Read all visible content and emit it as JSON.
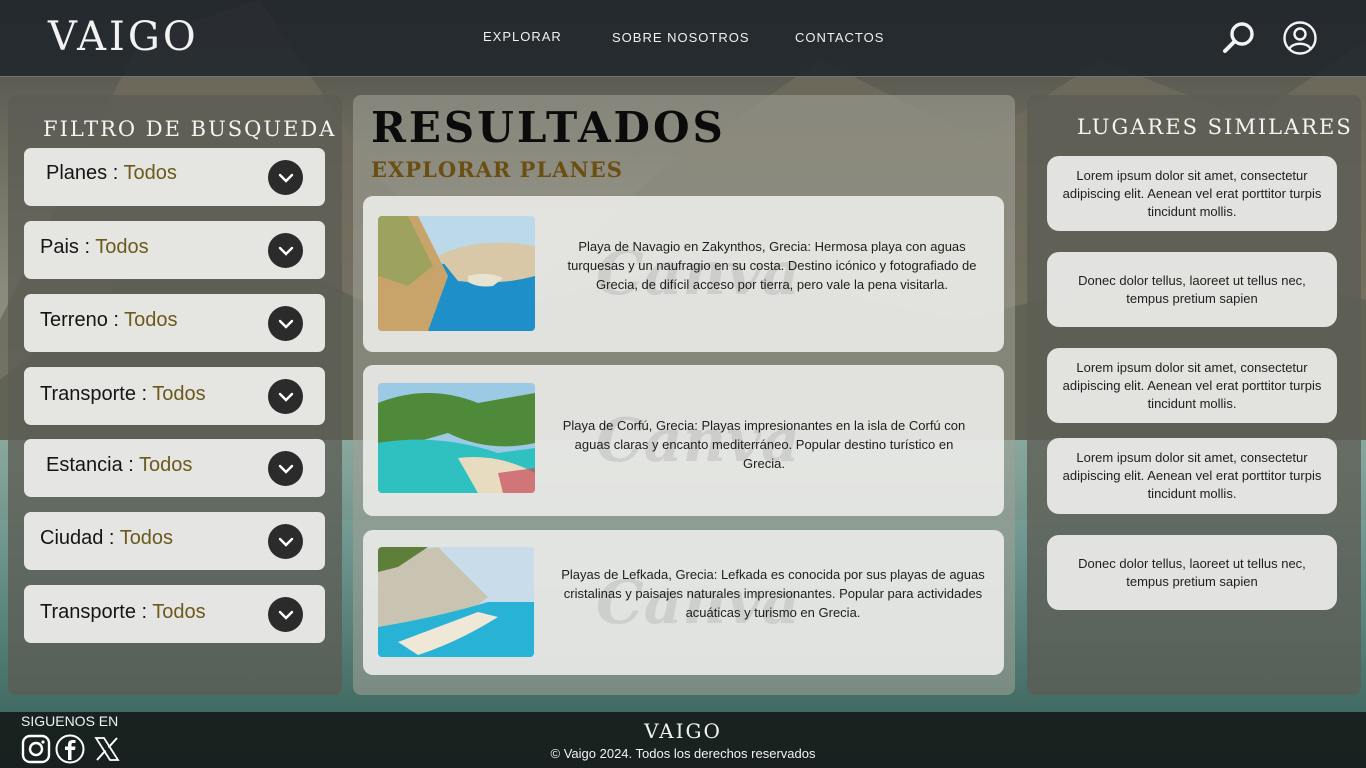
{
  "brand": {
    "name": "VAIGO"
  },
  "nav": {
    "items": [
      {
        "label": "EXPLORAR"
      },
      {
        "label": "SOBRE NOSOTROS"
      },
      {
        "label": "CONTACTOS"
      }
    ],
    "icons": [
      "search-icon",
      "user-icon"
    ]
  },
  "filters": {
    "title": "FILTRO DE BUSQUEDA",
    "items": [
      {
        "label": "Planes : ",
        "value": "Todos"
      },
      {
        "label": "Pais : ",
        "value": "Todos"
      },
      {
        "label": "Terreno : ",
        "value": "Todos"
      },
      {
        "label": "Transporte : ",
        "value": "Todos"
      },
      {
        "label": "Estancia : ",
        "value": "Todos"
      },
      {
        "label": "Ciudad : ",
        "value": "Todos"
      },
      {
        "label": "Transporte : ",
        "value": "Todos"
      }
    ]
  },
  "results": {
    "title": "RESULTADOS",
    "subtitle": "EXPLORAR PLANES",
    "watermark": "Canva",
    "items": [
      {
        "text": "Playa de Navagio en Zakynthos, Grecia: Hermosa playa con aguas turquesas y un naufragio en su costa. Destino icónico y fotografiado de Grecia, de difícil acceso por tierra, pero vale la pena visitarla."
      },
      {
        "text": "Playa de Corfú, Grecia: Playas impresionantes en la isla de Corfú con aguas claras y encanto mediterráneo. Popular destino turístico en Grecia."
      },
      {
        "text": "Playas de Lefkada, Grecia: Lefkada es conocida por sus playas de aguas cristalinas y paisajes naturales impresionantes. Popular para actividades acuáticas y turismo en Grecia."
      }
    ]
  },
  "similar": {
    "title": "LUGARES SIMILARES",
    "items": [
      {
        "text": "Lorem ipsum dolor sit amet, consectetur adipiscing elit. Aenean vel erat porttitor turpis tincidunt mollis."
      },
      {
        "text": "Donec dolor tellus, laoreet ut tellus nec, tempus pretium sapien"
      },
      {
        "text": "Lorem ipsum dolor sit amet, consectetur adipiscing elit. Aenean vel erat porttitor turpis tincidunt mollis."
      },
      {
        "text": "Lorem ipsum dolor sit amet, consectetur adipiscing elit. Aenean vel erat porttitor turpis tincidunt mollis."
      },
      {
        "text": "Donec dolor tellus, laoreet ut tellus nec, tempus pretium sapien"
      }
    ]
  },
  "footer": {
    "follow_label": "SIGUENOS EN",
    "social_icons": [
      "instagram-icon",
      "facebook-icon",
      "x-icon"
    ],
    "brand": "VAIGO",
    "copyright": "© Vaigo 2024. Todos los derechos reservados"
  },
  "colors": {
    "accent_gold": "#6b5a1c",
    "subtitle_brown": "#6b4f12",
    "nav_bg": "#20262c",
    "footer_bg": "#161e1c"
  }
}
